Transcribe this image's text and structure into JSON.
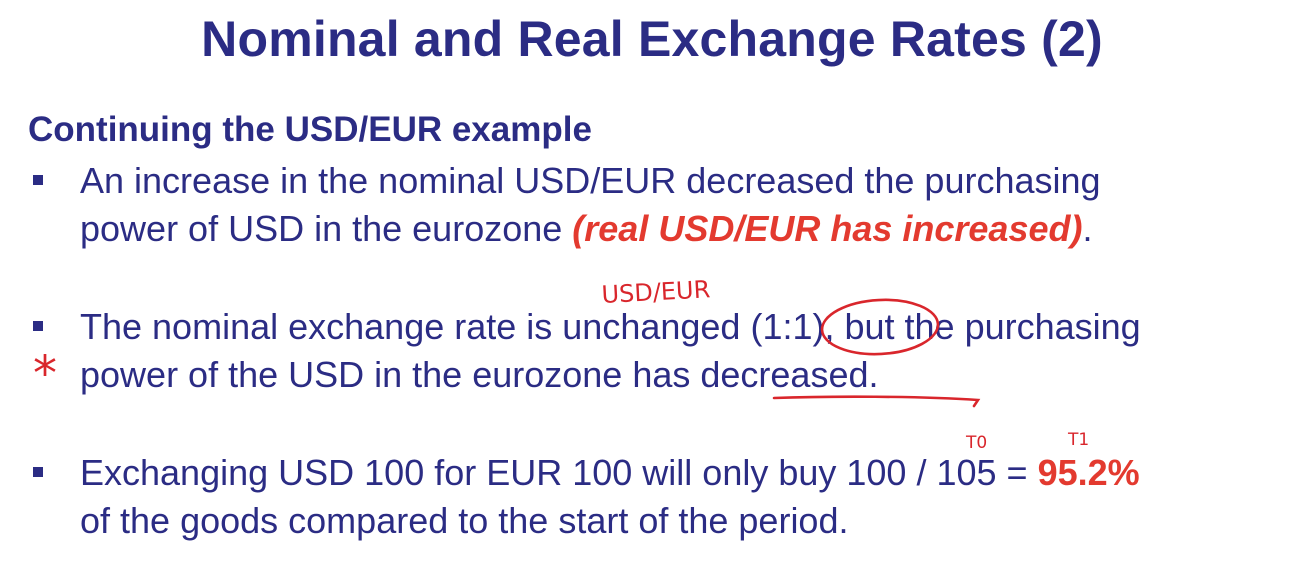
{
  "title": "Nominal and Real Exchange Rates (2)",
  "subheading": "Continuing the USD/EUR example",
  "bullets": [
    {
      "line1": "An increase in the nominal USD/EUR decreased the purchasing",
      "line2_prefix": "power of USD in the eurozone ",
      "line2_emphasis": "(real USD/EUR has increased)",
      "line2_suffix": "."
    },
    {
      "line1_prefix": "The nominal exchange rate is unchanged ",
      "line1_ratio": "(1:1)",
      "line1_suffix": ", but the purchasing",
      "line2_prefix": "power of the USD in the eurozone has ",
      "line2_word": "decreased",
      "line2_suffix": "."
    },
    {
      "line1_prefix": "Exchanging USD 100 for EUR 100 will only buy 100 / 105 = ",
      "line1_result": "95.2%",
      "line2": "of the goods compared to the start of the period."
    }
  ],
  "annotations": {
    "above_ratio": "USD/EUR",
    "star": "*",
    "t0": "T0",
    "t1": "T1"
  },
  "colors": {
    "text": "#2b2c84",
    "emphasis": "#e33a2f",
    "ink": "#d9262c"
  }
}
